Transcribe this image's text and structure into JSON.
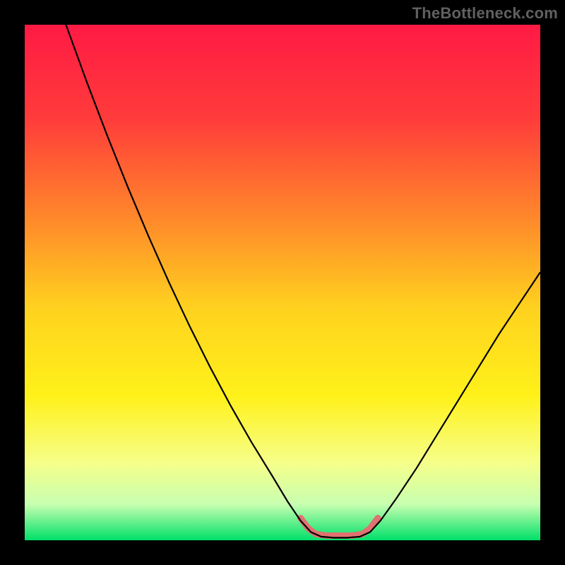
{
  "attribution": "TheBottleneck.com",
  "chart_data": {
    "type": "line",
    "title": "",
    "xlabel": "",
    "ylabel": "",
    "xlim": [
      0,
      100
    ],
    "ylim": [
      0,
      100
    ],
    "background_gradient": {
      "stops": [
        {
          "offset": 0.0,
          "color": "#ff1a44"
        },
        {
          "offset": 0.18,
          "color": "#ff3b3b"
        },
        {
          "offset": 0.38,
          "color": "#ff8a2a"
        },
        {
          "offset": 0.55,
          "color": "#ffd21f"
        },
        {
          "offset": 0.72,
          "color": "#fff11a"
        },
        {
          "offset": 0.85,
          "color": "#f6ff8a"
        },
        {
          "offset": 0.93,
          "color": "#c8ffb0"
        },
        {
          "offset": 1.0,
          "color": "#00e06a"
        }
      ]
    },
    "series": [
      {
        "name": "bottleneck-curve",
        "color": "#000000",
        "width": 2.2,
        "points": [
          {
            "x": 8.0,
            "y": 100.0
          },
          {
            "x": 12.0,
            "y": 89.0
          },
          {
            "x": 16.0,
            "y": 78.5
          },
          {
            "x": 20.0,
            "y": 68.5
          },
          {
            "x": 24.0,
            "y": 59.0
          },
          {
            "x": 28.0,
            "y": 50.0
          },
          {
            "x": 32.0,
            "y": 41.5
          },
          {
            "x": 36.0,
            "y": 33.5
          },
          {
            "x": 40.0,
            "y": 26.0
          },
          {
            "x": 44.0,
            "y": 19.0
          },
          {
            "x": 48.0,
            "y": 12.5
          },
          {
            "x": 51.0,
            "y": 7.5
          },
          {
            "x": 53.5,
            "y": 3.8
          },
          {
            "x": 55.5,
            "y": 1.6
          },
          {
            "x": 57.5,
            "y": 0.7
          },
          {
            "x": 60.0,
            "y": 0.5
          },
          {
            "x": 62.5,
            "y": 0.5
          },
          {
            "x": 65.0,
            "y": 0.7
          },
          {
            "x": 67.0,
            "y": 1.6
          },
          {
            "x": 69.0,
            "y": 3.8
          },
          {
            "x": 72.0,
            "y": 8.0
          },
          {
            "x": 76.0,
            "y": 14.0
          },
          {
            "x": 80.0,
            "y": 20.5
          },
          {
            "x": 84.0,
            "y": 27.0
          },
          {
            "x": 88.0,
            "y": 33.5
          },
          {
            "x": 92.0,
            "y": 40.0
          },
          {
            "x": 96.0,
            "y": 46.0
          },
          {
            "x": 100.0,
            "y": 52.0
          }
        ]
      },
      {
        "name": "flat-zone-marker",
        "color": "#e17070",
        "width": 9,
        "round_caps": true,
        "points": [
          {
            "x": 53.5,
            "y": 4.3
          },
          {
            "x": 55.0,
            "y": 2.3
          },
          {
            "x": 56.5,
            "y": 1.2
          },
          {
            "x": 58.5,
            "y": 0.9
          },
          {
            "x": 61.0,
            "y": 0.9
          },
          {
            "x": 63.5,
            "y": 0.9
          },
          {
            "x": 65.5,
            "y": 1.2
          },
          {
            "x": 67.0,
            "y": 2.3
          },
          {
            "x": 68.5,
            "y": 4.3
          }
        ]
      }
    ]
  }
}
